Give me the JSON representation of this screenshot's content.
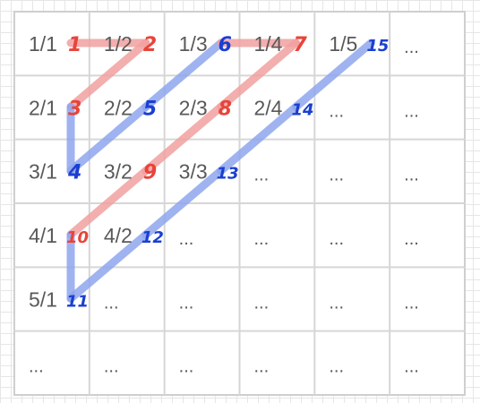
{
  "grid": {
    "rows": [
      [
        "1/1",
        "1/2",
        "1/3",
        "1/4",
        "1/5",
        "..."
      ],
      [
        "2/1",
        "2/2",
        "2/3",
        "2/4",
        "...",
        "..."
      ],
      [
        "3/1",
        "3/2",
        "3/3",
        "...",
        "...",
        "..."
      ],
      [
        "4/1",
        "4/2",
        "...",
        "...",
        "...",
        "..."
      ],
      [
        "5/1",
        "...",
        "...",
        "...",
        "...",
        "..."
      ],
      [
        "...",
        "...",
        "...",
        "...",
        "...",
        "..."
      ]
    ]
  },
  "path": {
    "red_color": "#e8443a",
    "blue_color": "#1a3fd1",
    "red_stroke_color": "#f2a0a0",
    "blue_stroke_color": "#8fa6ee",
    "markers": [
      {
        "number": "1",
        "row": 0,
        "col": 0,
        "color": "red"
      },
      {
        "number": "2",
        "row": 0,
        "col": 1,
        "color": "red"
      },
      {
        "number": "3",
        "row": 1,
        "col": 0,
        "color": "red"
      },
      {
        "number": "4",
        "row": 2,
        "col": 0,
        "color": "blue"
      },
      {
        "number": "5",
        "row": 1,
        "col": 1,
        "color": "blue"
      },
      {
        "number": "6",
        "row": 0,
        "col": 2,
        "color": "blue"
      },
      {
        "number": "7",
        "row": 0,
        "col": 3,
        "color": "red"
      },
      {
        "number": "8",
        "row": 1,
        "col": 2,
        "color": "red"
      },
      {
        "number": "9",
        "row": 2,
        "col": 1,
        "color": "red"
      },
      {
        "number": "10",
        "row": 3,
        "col": 0,
        "color": "red"
      },
      {
        "number": "11",
        "row": 4,
        "col": 0,
        "color": "blue"
      },
      {
        "number": "12",
        "row": 3,
        "col": 1,
        "color": "blue"
      },
      {
        "number": "13",
        "row": 2,
        "col": 2,
        "color": "blue"
      },
      {
        "number": "14",
        "row": 1,
        "col": 3,
        "color": "blue"
      },
      {
        "number": "15",
        "row": 0,
        "col": 4,
        "color": "blue"
      }
    ],
    "segments": [
      {
        "from": "1",
        "to": "2",
        "color": "red"
      },
      {
        "from": "2",
        "to": "3",
        "color": "red"
      },
      {
        "from": "3",
        "to": "4",
        "color": "blue"
      },
      {
        "from": "4",
        "to": "5",
        "color": "blue"
      },
      {
        "from": "5",
        "to": "6",
        "color": "blue"
      },
      {
        "from": "6",
        "to": "7",
        "color": "red"
      },
      {
        "from": "7",
        "to": "8",
        "color": "red"
      },
      {
        "from": "8",
        "to": "9",
        "color": "red"
      },
      {
        "from": "9",
        "to": "10",
        "color": "red"
      },
      {
        "from": "10",
        "to": "11",
        "color": "blue"
      },
      {
        "from": "11",
        "to": "12",
        "color": "blue"
      },
      {
        "from": "12",
        "to": "13",
        "color": "blue"
      },
      {
        "from": "13",
        "to": "14",
        "color": "blue"
      },
      {
        "from": "14",
        "to": "15",
        "color": "blue"
      }
    ]
  }
}
